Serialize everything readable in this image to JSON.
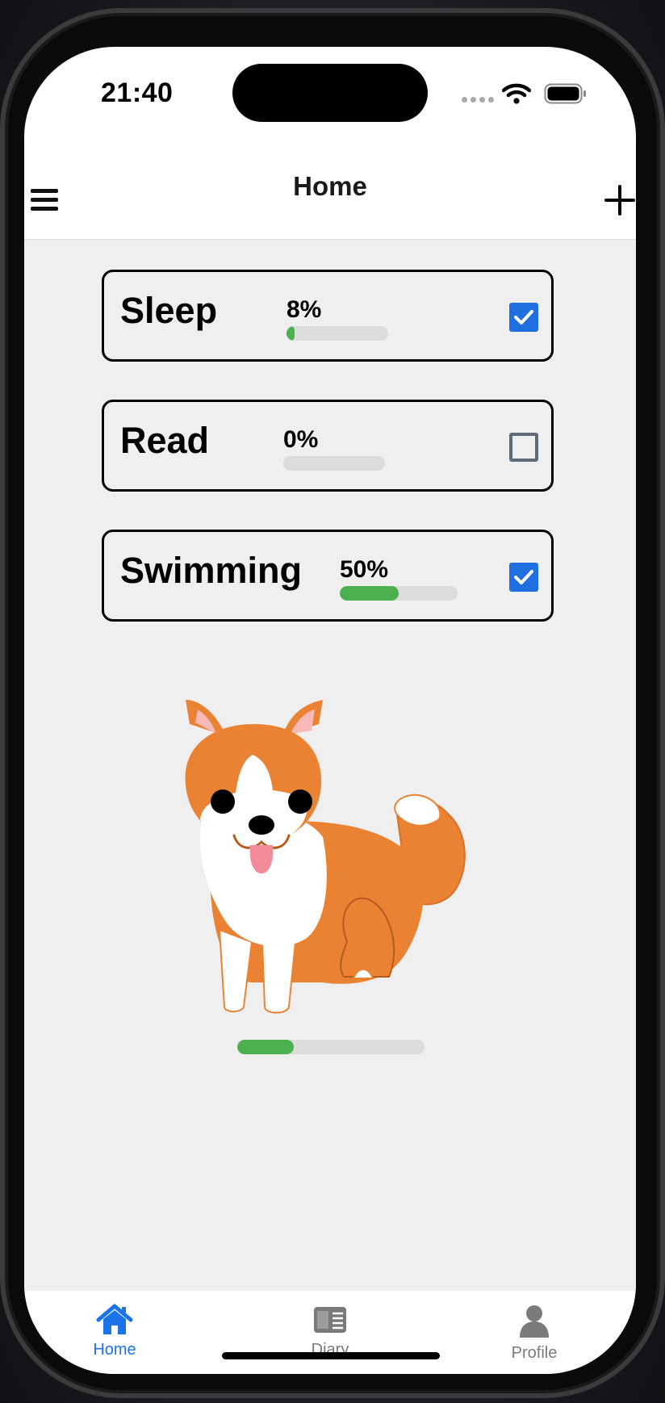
{
  "status_bar": {
    "time": "21:40"
  },
  "nav": {
    "title": "Home"
  },
  "habits": [
    {
      "name": "Sleep",
      "progress_label": "8%",
      "progress": 0.08,
      "checked": true
    },
    {
      "name": "Read",
      "progress_label": "0%",
      "progress": 0.0,
      "checked": false
    },
    {
      "name": "Swimming",
      "progress_label": "50%",
      "progress": 0.5,
      "checked": true
    }
  ],
  "pet": {
    "image": "corgi-dog-illustration",
    "progress": 0.3
  },
  "tabs": [
    {
      "label": "Home",
      "icon": "house-icon",
      "active": true
    },
    {
      "label": "Diary",
      "icon": "diary-icon",
      "active": false
    },
    {
      "label": "Profile",
      "icon": "person-icon",
      "active": false
    }
  ],
  "colors": {
    "accent": "#1f6fe0",
    "progress_green": "#4caf50",
    "tab_active": "#1a73e8",
    "tab_inactive": "#7a7a7a",
    "background": "#efefef"
  }
}
